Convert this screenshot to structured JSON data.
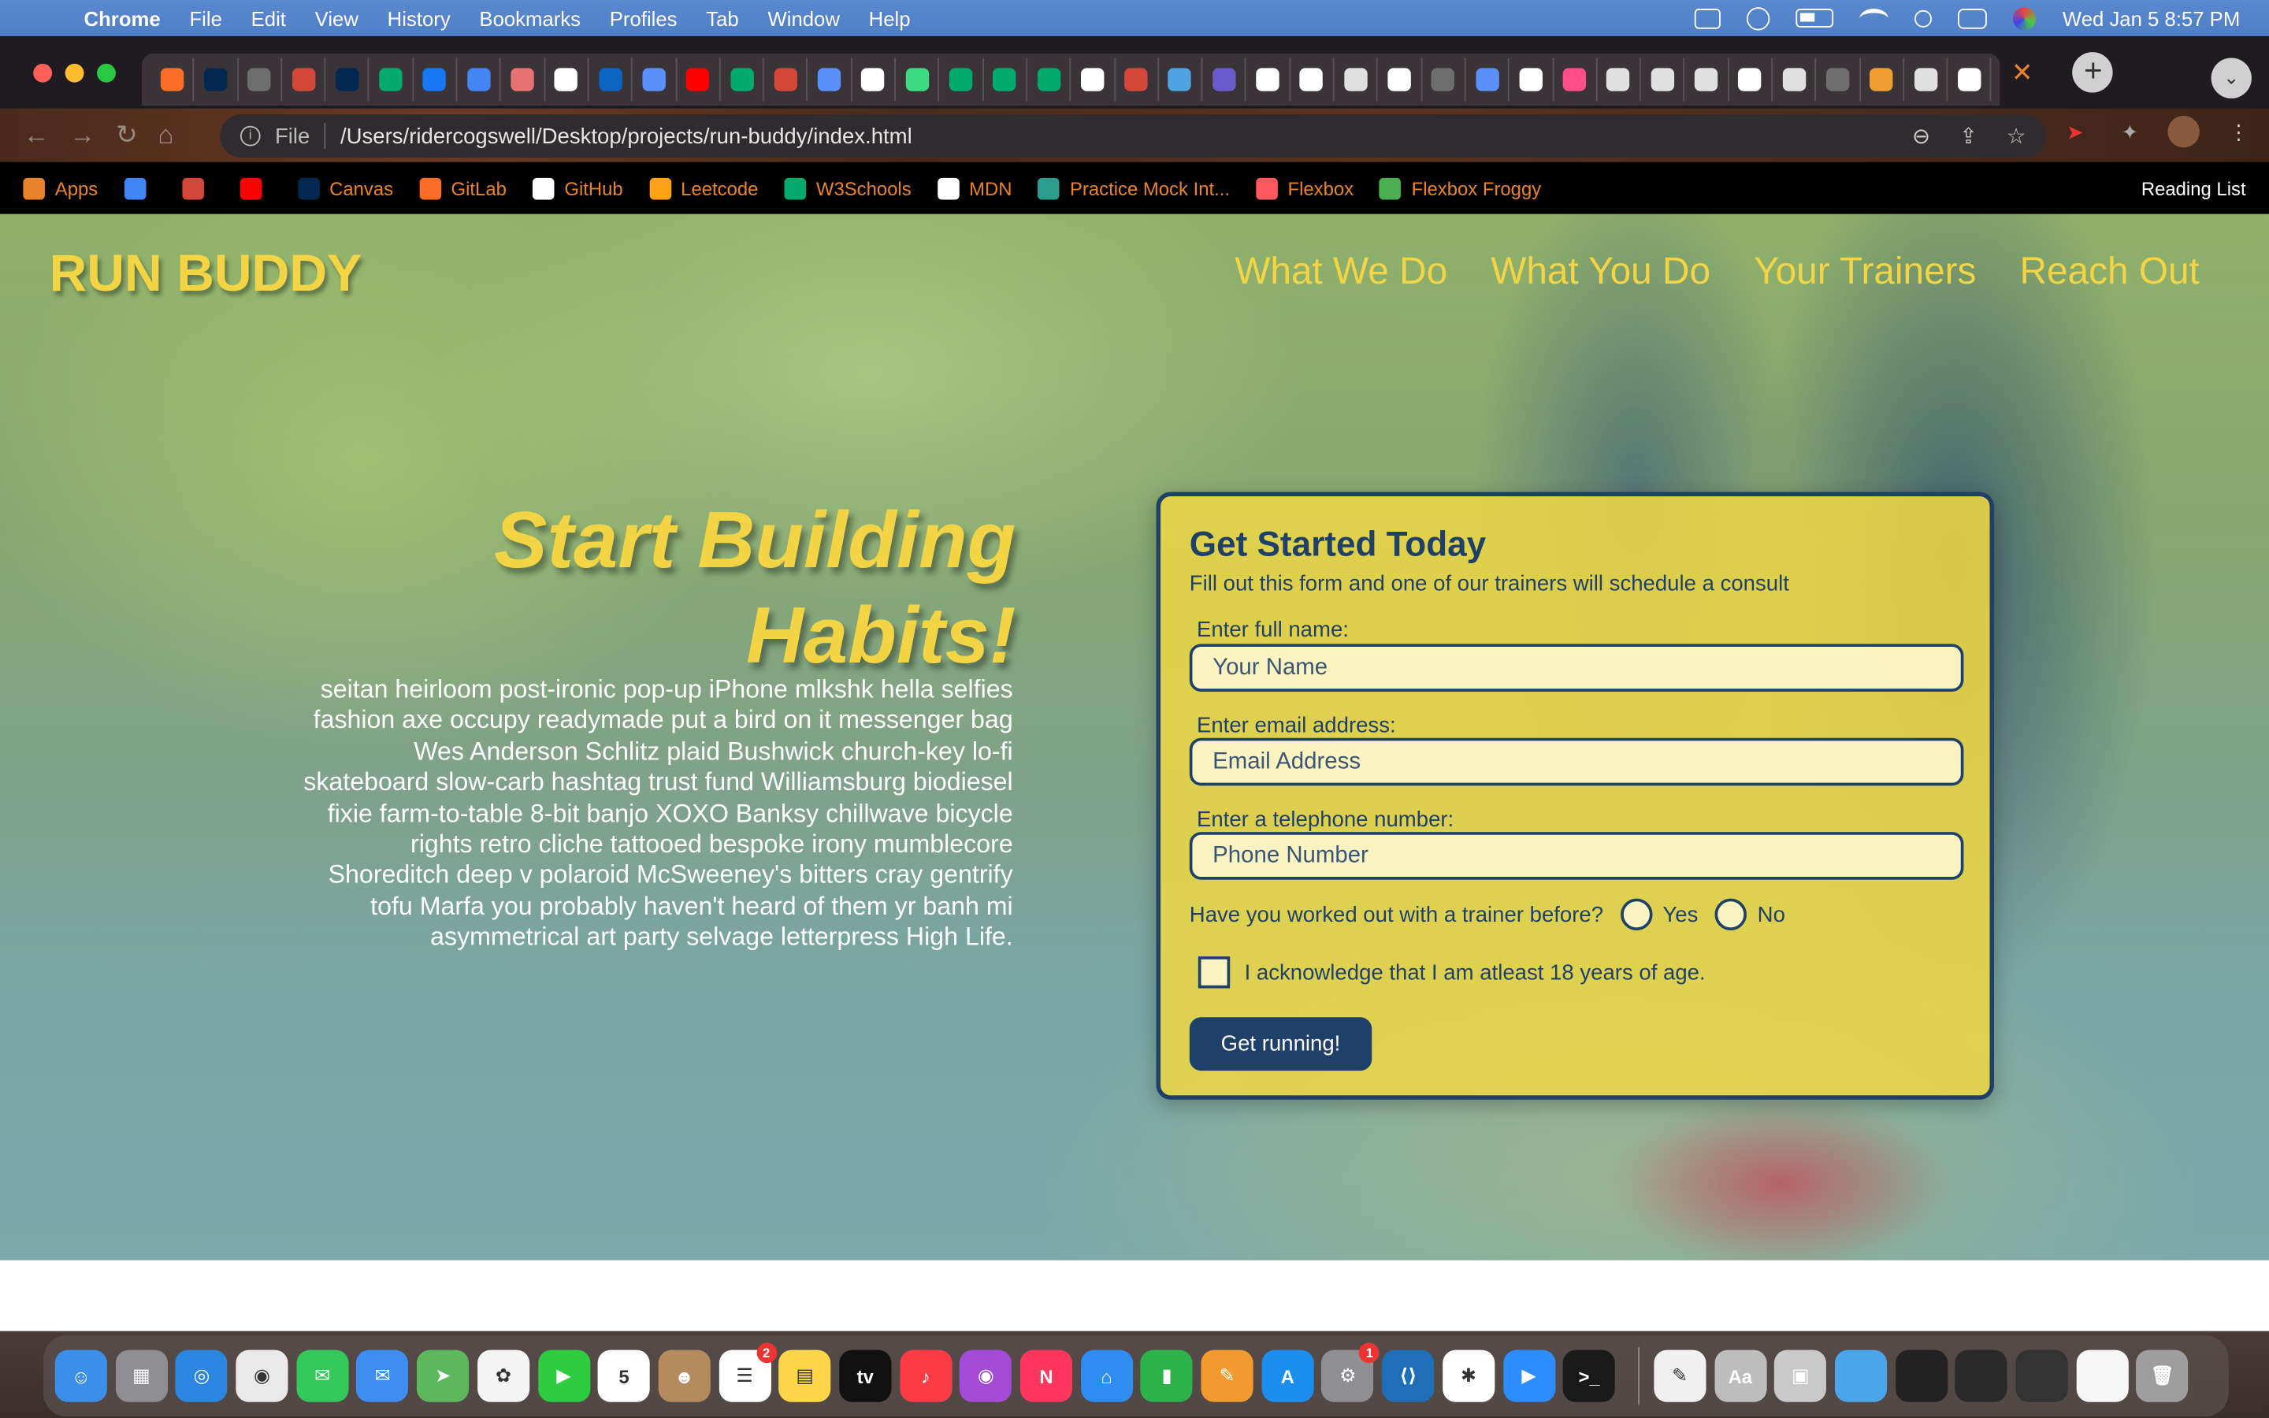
{
  "menubar": {
    "app": "Chrome",
    "menus": [
      "File",
      "Edit",
      "View",
      "History",
      "Bookmarks",
      "Profiles",
      "Tab",
      "Window",
      "Help"
    ],
    "clock": "Wed Jan 5  8:57 PM"
  },
  "tabs": {
    "favicons": [
      "gitlab",
      "ucdavis",
      "github",
      "gmail",
      "ucdavis",
      "w3",
      "facebook",
      "docs",
      "d",
      "google",
      "linkedin",
      "bookmark",
      "youtube",
      "w3",
      "gmail",
      "bookmark",
      "figma",
      "android",
      "w3",
      "w3",
      "w3",
      "google",
      "gmail",
      "info",
      "hackerrank",
      "google",
      "google",
      "chrome",
      "google",
      "github",
      "bookmark",
      "google",
      "drop",
      "chrome",
      "chrome",
      "chrome",
      "google",
      "chrome",
      "github",
      "orange",
      "chrome",
      "google"
    ],
    "close_label": "✕",
    "new_tab_label": "+",
    "tab_search_label": "⌄"
  },
  "address_bar": {
    "scheme_label": "File",
    "url": "/Users/ridercogswell/Desktop/projects/run-buddy/index.html"
  },
  "bookmarks": {
    "items": [
      {
        "label": "Apps",
        "icon": "apps-grid-icon",
        "color": "#e8832a"
      },
      {
        "label": "",
        "icon": "google-docs-icon",
        "color": "#4285f4"
      },
      {
        "label": "",
        "icon": "gmail-icon",
        "color": "#d44638"
      },
      {
        "label": "",
        "icon": "youtube-icon",
        "color": "#ff0000"
      },
      {
        "label": "Canvas",
        "icon": "ucdavis-icon",
        "color": "#022851"
      },
      {
        "label": "GitLab",
        "icon": "gitlab-icon",
        "color": "#fc6d26"
      },
      {
        "label": "GitHub",
        "icon": "github-icon",
        "color": "#ffffff"
      },
      {
        "label": "Leetcode",
        "icon": "leetcode-icon",
        "color": "#ffa116"
      },
      {
        "label": "W3Schools",
        "icon": "w3schools-icon",
        "color": "#04aa6d"
      },
      {
        "label": "MDN",
        "icon": "mdn-icon",
        "color": "#ffffff"
      },
      {
        "label": "Practice Mock Int...",
        "icon": "check-badge-icon",
        "color": "#2a9d8f"
      },
      {
        "label": "Flexbox",
        "icon": "flexbox-icon",
        "color": "#ff5a5f"
      },
      {
        "label": "Flexbox Froggy",
        "icon": "frog-icon",
        "color": "#4caf50"
      }
    ],
    "reading_list": "Reading List"
  },
  "page": {
    "logo": "RUN BUDDY",
    "nav": [
      "What We Do",
      "What You Do",
      "Your Trainers",
      "Reach Out"
    ],
    "headline_line1": "Start Building",
    "headline_line2": "Habits!",
    "body": "seitan heirloom post-ironic pop-up iPhone mlkshk hella selfies fashion axe occupy readymade put a bird on it messenger bag Wes Anderson Schlitz plaid Bushwick church-key lo-fi skateboard slow-carb hashtag trust fund Williamsburg biodiesel fixie farm-to-table 8-bit banjo XOXO Banksy chillwave bicycle rights retro cliche tattooed bespoke irony mumblecore Shoreditch deep v polaroid McSweeney's bitters cray gentrify tofu Marfa you probably haven't heard of them yr banh mi asymmetrical art party selvage letterpress High Life.",
    "form": {
      "title": "Get Started Today",
      "subtitle": "Fill out this form and one of our trainers will schedule a consult",
      "name_label": "Enter full name:",
      "name_placeholder": "Your Name",
      "email_label": "Enter email address:",
      "email_placeholder": "Email Address",
      "phone_label": "Enter a telephone number:",
      "phone_placeholder": "Phone Number",
      "trainer_question": "Have you worked out with a trainer before?",
      "yes_label": "Yes",
      "no_label": "No",
      "age_ack": "I acknowledge that I am atleast 18 years of age.",
      "submit_label": "Get running!"
    }
  },
  "dock": {
    "apps": [
      {
        "name": "finder",
        "color": "#3b8fe8",
        "glyph": "☺"
      },
      {
        "name": "launchpad",
        "color": "#8e8e93",
        "glyph": "▦"
      },
      {
        "name": "safari",
        "color": "#2a86e0",
        "glyph": "◎"
      },
      {
        "name": "chrome",
        "color": "#e9e9e9",
        "glyph": "◉"
      },
      {
        "name": "messages",
        "color": "#34c759",
        "glyph": "✉"
      },
      {
        "name": "mail",
        "color": "#3d8ef0",
        "glyph": "✉"
      },
      {
        "name": "maps",
        "color": "#5cb85c",
        "glyph": "➤"
      },
      {
        "name": "photos",
        "color": "#f4f4f4",
        "glyph": "✿"
      },
      {
        "name": "facetime",
        "color": "#2ecc40",
        "glyph": "▶"
      },
      {
        "name": "calendar",
        "color": "#ffffff",
        "glyph": "5"
      },
      {
        "name": "contacts",
        "color": "#b58a5c",
        "glyph": "☻"
      },
      {
        "name": "reminders",
        "color": "#ffffff",
        "glyph": "☰",
        "badge": "2"
      },
      {
        "name": "notes",
        "color": "#ffd54a",
        "glyph": "▤"
      },
      {
        "name": "apple-tv",
        "color": "#111111",
        "glyph": "tv"
      },
      {
        "name": "music",
        "color": "#fc3c44",
        "glyph": "♪"
      },
      {
        "name": "podcasts",
        "color": "#a34bd6",
        "glyph": "◉"
      },
      {
        "name": "news",
        "color": "#ff375f",
        "glyph": "N"
      },
      {
        "name": "keynote",
        "color": "#2f8cf0",
        "glyph": "⌂"
      },
      {
        "name": "numbers",
        "color": "#2cb34a",
        "glyph": "▮"
      },
      {
        "name": "pages",
        "color": "#f29a2e",
        "glyph": "✎"
      },
      {
        "name": "app-store",
        "color": "#1c8ef0",
        "glyph": "A"
      },
      {
        "name": "system-preferences",
        "color": "#8e8e93",
        "glyph": "⚙",
        "badge": "1"
      },
      {
        "name": "vscode",
        "color": "#1f6fb8",
        "glyph": "⟨⟩"
      },
      {
        "name": "slack",
        "color": "#ffffff",
        "glyph": "✱"
      },
      {
        "name": "zoom",
        "color": "#2d8cff",
        "glyph": "▶"
      },
      {
        "name": "terminal",
        "color": "#1a1a1a",
        "glyph": ">_"
      }
    ],
    "right_items": [
      {
        "name": "textedit",
        "color": "#f0f0f0",
        "glyph": "✎"
      },
      {
        "name": "font-book",
        "color": "#bdbdbd",
        "glyph": "Aa"
      },
      {
        "name": "preview",
        "color": "#c9c9c9",
        "glyph": "▣"
      },
      {
        "name": "downloads-folder",
        "color": "#4aa6e8",
        "glyph": ""
      },
      {
        "name": "minimized-window-1",
        "color": "#222222",
        "glyph": ""
      },
      {
        "name": "minimized-window-2",
        "color": "#2a2a2a",
        "glyph": ""
      },
      {
        "name": "minimized-window-3",
        "color": "#333333",
        "glyph": ""
      },
      {
        "name": "minimized-window-4",
        "color": "#f6f6f6",
        "glyph": ""
      },
      {
        "name": "trash",
        "color": "#9e9e9e",
        "glyph": "🗑"
      }
    ]
  }
}
